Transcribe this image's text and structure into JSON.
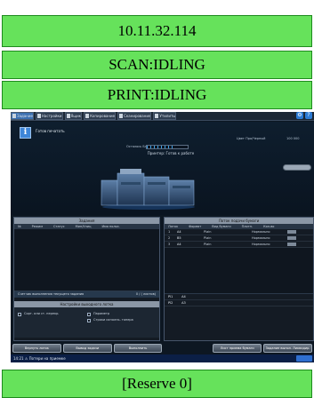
{
  "status_bars": {
    "ip_address": "10.11.32.114",
    "scan_status": "SCAN:IDLING",
    "print_status": "PRINT:IDLING",
    "reserve": "[Reserve 0]"
  },
  "panel": {
    "tabs": [
      {
        "label": "Задание",
        "active": true
      },
      {
        "label": "Настройки"
      },
      {
        "label": "Ящик"
      },
      {
        "label": "Копирование"
      },
      {
        "label": "Сканирование"
      },
      {
        "label": "Утилиты"
      }
    ],
    "message": "Готов печатать",
    "toner_label": "Осталось  Блок",
    "counter_labels": "Цвет Про/Черный",
    "counter_values": "100 000",
    "status_caption": "Принтер: Готов к работе",
    "jobs_header": "Задания",
    "jobs_columns": [
      "№",
      "Режим",
      "Статус",
      "Мин/Улиц",
      "Имя польз."
    ],
    "jobs_footer_left": "Счетчик выполнения текущего задания",
    "jobs_footer_right": "0 / ( листов)",
    "mode_header": "Настройки выходного лотка",
    "mode_option_1": "Сорт.  или ст. перекр.",
    "mode_option_2": "Параметр",
    "mode_option_3": "Строки  исполнь.  тонера",
    "trays_header": "Лоток подачи бумаги",
    "trays_columns": [
      "Лоток",
      "Формат",
      "Вид бумаги",
      "Плотн.",
      "Кол-во"
    ],
    "trays": [
      {
        "no": "1",
        "size": "A4",
        "type": "Plain",
        "state": "Нормально"
      },
      {
        "no": "2",
        "size": "B5",
        "type": "Plain",
        "state": "Нормально"
      },
      {
        "no": "3",
        "size": "A4",
        "type": "Plain",
        "state": "Нормально"
      }
    ],
    "bypass_rows": [
      {
        "no": "PI1",
        "size": "A4"
      },
      {
        "no": "PI2",
        "size": "A3"
      }
    ],
    "buttons": [
      "Вернуть лоток",
      "Вывод задачи",
      "Выполнить",
      "Лист приема бумаги",
      "Задание выпол. Ликвидир."
    ],
    "status_strip": "14:21  ⚠ Потери на приемке"
  }
}
